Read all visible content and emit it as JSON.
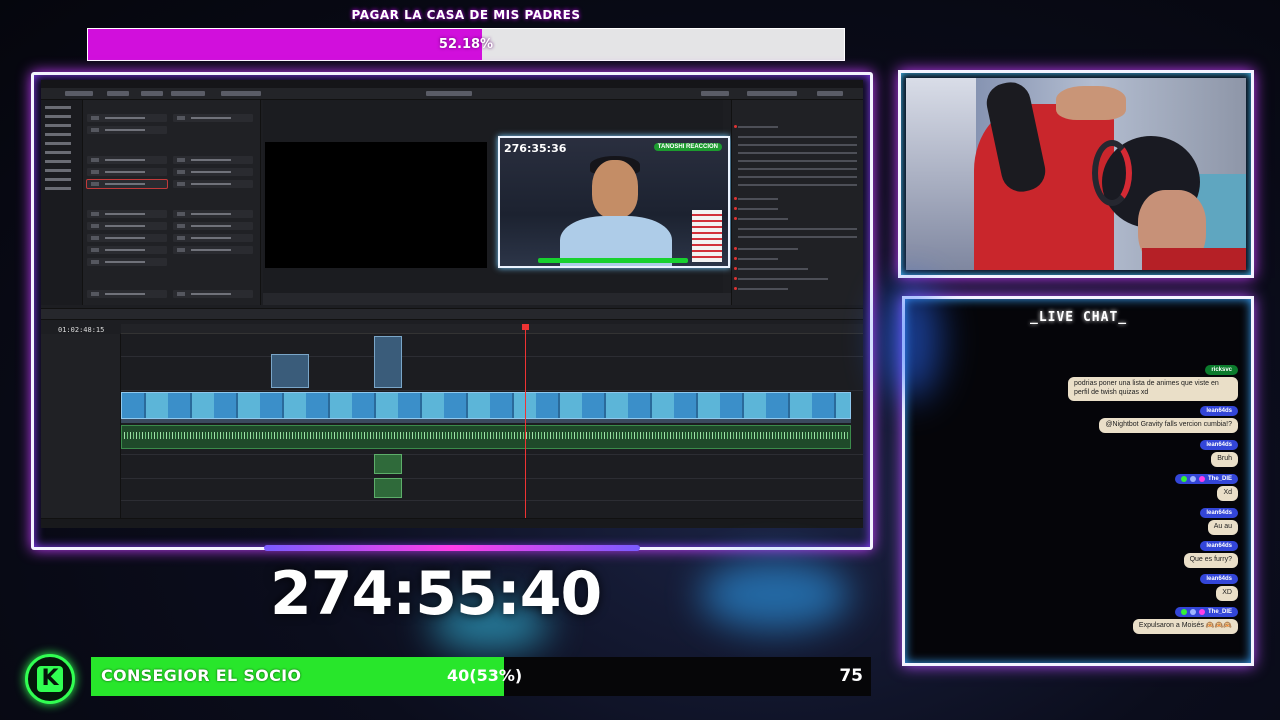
{
  "goal_top": {
    "title": "PAGAR LA CASA DE MIS PADRES",
    "percent_label": "52.18%",
    "progress": 0.5218,
    "fill_color": "#d10fdc"
  },
  "editor_preview": {
    "timer": "276:35:36",
    "tag": "TANOSHI REACCION"
  },
  "editor": {
    "timecode": "01:02:48:15"
  },
  "chat": {
    "title": "_LIVE CHAT_",
    "messages": [
      {
        "user": "ricksvc",
        "style": "green",
        "badges": [],
        "text": "podrias poner una lista de animes que viste en perfil de twish quizas xd"
      },
      {
        "user": "lean64ds",
        "style": "blue",
        "badges": [],
        "text": "@Nightbot Gravity falls vercion cumbia!?"
      },
      {
        "user": "lean64ds",
        "style": "blue",
        "badges": [],
        "text": "Bruh"
      },
      {
        "user": "The_DIE",
        "style": "blue",
        "badges": [
          "#35f236",
          "#9fb4ff",
          "#ff3ee8"
        ],
        "text": "Xd"
      },
      {
        "user": "lean64ds",
        "style": "blue",
        "badges": [],
        "text": "Au au"
      },
      {
        "user": "lean64ds",
        "style": "blue",
        "badges": [],
        "text": "Que es furry?"
      },
      {
        "user": "lean64ds",
        "style": "blue",
        "badges": [],
        "text": "XD"
      },
      {
        "user": "The_DIE",
        "style": "blue",
        "badges": [
          "#35f236",
          "#9fb4ff",
          "#ff3ee8"
        ],
        "text": "Expulsaron a Moisés 🙉🙉🙉"
      }
    ]
  },
  "countdown": "274:55:40",
  "goal_bottom": {
    "title": "CONSEGIOR EL SOCIO",
    "current_label": "40(53%)",
    "target": "75",
    "progress": 0.53,
    "fill_color": "#28e62b"
  },
  "platform_icon": "kick-logo-icon",
  "platform_letter": "K"
}
